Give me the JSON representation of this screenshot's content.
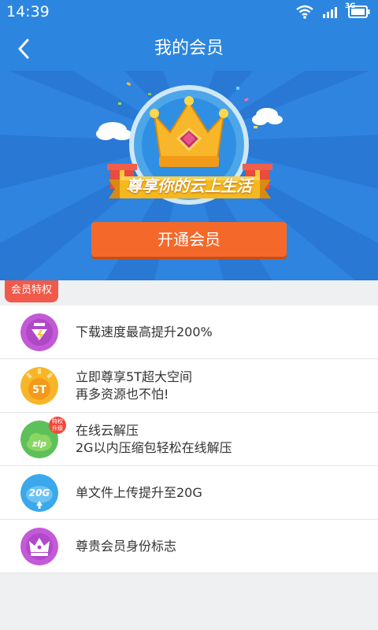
{
  "status_bar": {
    "time": "14:39",
    "network": "3G",
    "icons": [
      "wifi-icon",
      "signal-icon",
      "battery-icon"
    ]
  },
  "header": {
    "title": "我的会员",
    "back_icon": "chevron-left-icon"
  },
  "banner": {
    "slogan": "尊享你的云上生活",
    "button_label": "开通会员",
    "colors": {
      "background": "#2f84df",
      "button": "#f4692a",
      "ribbon": "#f5b81f"
    }
  },
  "privileges": {
    "tag_label": "会员特权",
    "items": [
      {
        "icon": "download-speed-icon",
        "line1": "下载速度最高提升200%",
        "line2": "",
        "icon_label": ""
      },
      {
        "icon": "storage-5t-icon",
        "line1": "立即尊享5T超大空间",
        "line2": "再多资源也不怕!",
        "icon_label": "5T"
      },
      {
        "icon": "zip-cloud-icon",
        "line1": "在线云解压",
        "line2": "2G以内压缩包轻松在线解压",
        "icon_label": "zip",
        "badge": "特权升级"
      },
      {
        "icon": "upload-20g-icon",
        "line1": "单文件上传提升至20G",
        "line2": "",
        "icon_label": "20G"
      },
      {
        "icon": "vip-crown-icon",
        "line1": "尊贵会员身份标志",
        "line2": "",
        "icon_label": ""
      }
    ]
  }
}
